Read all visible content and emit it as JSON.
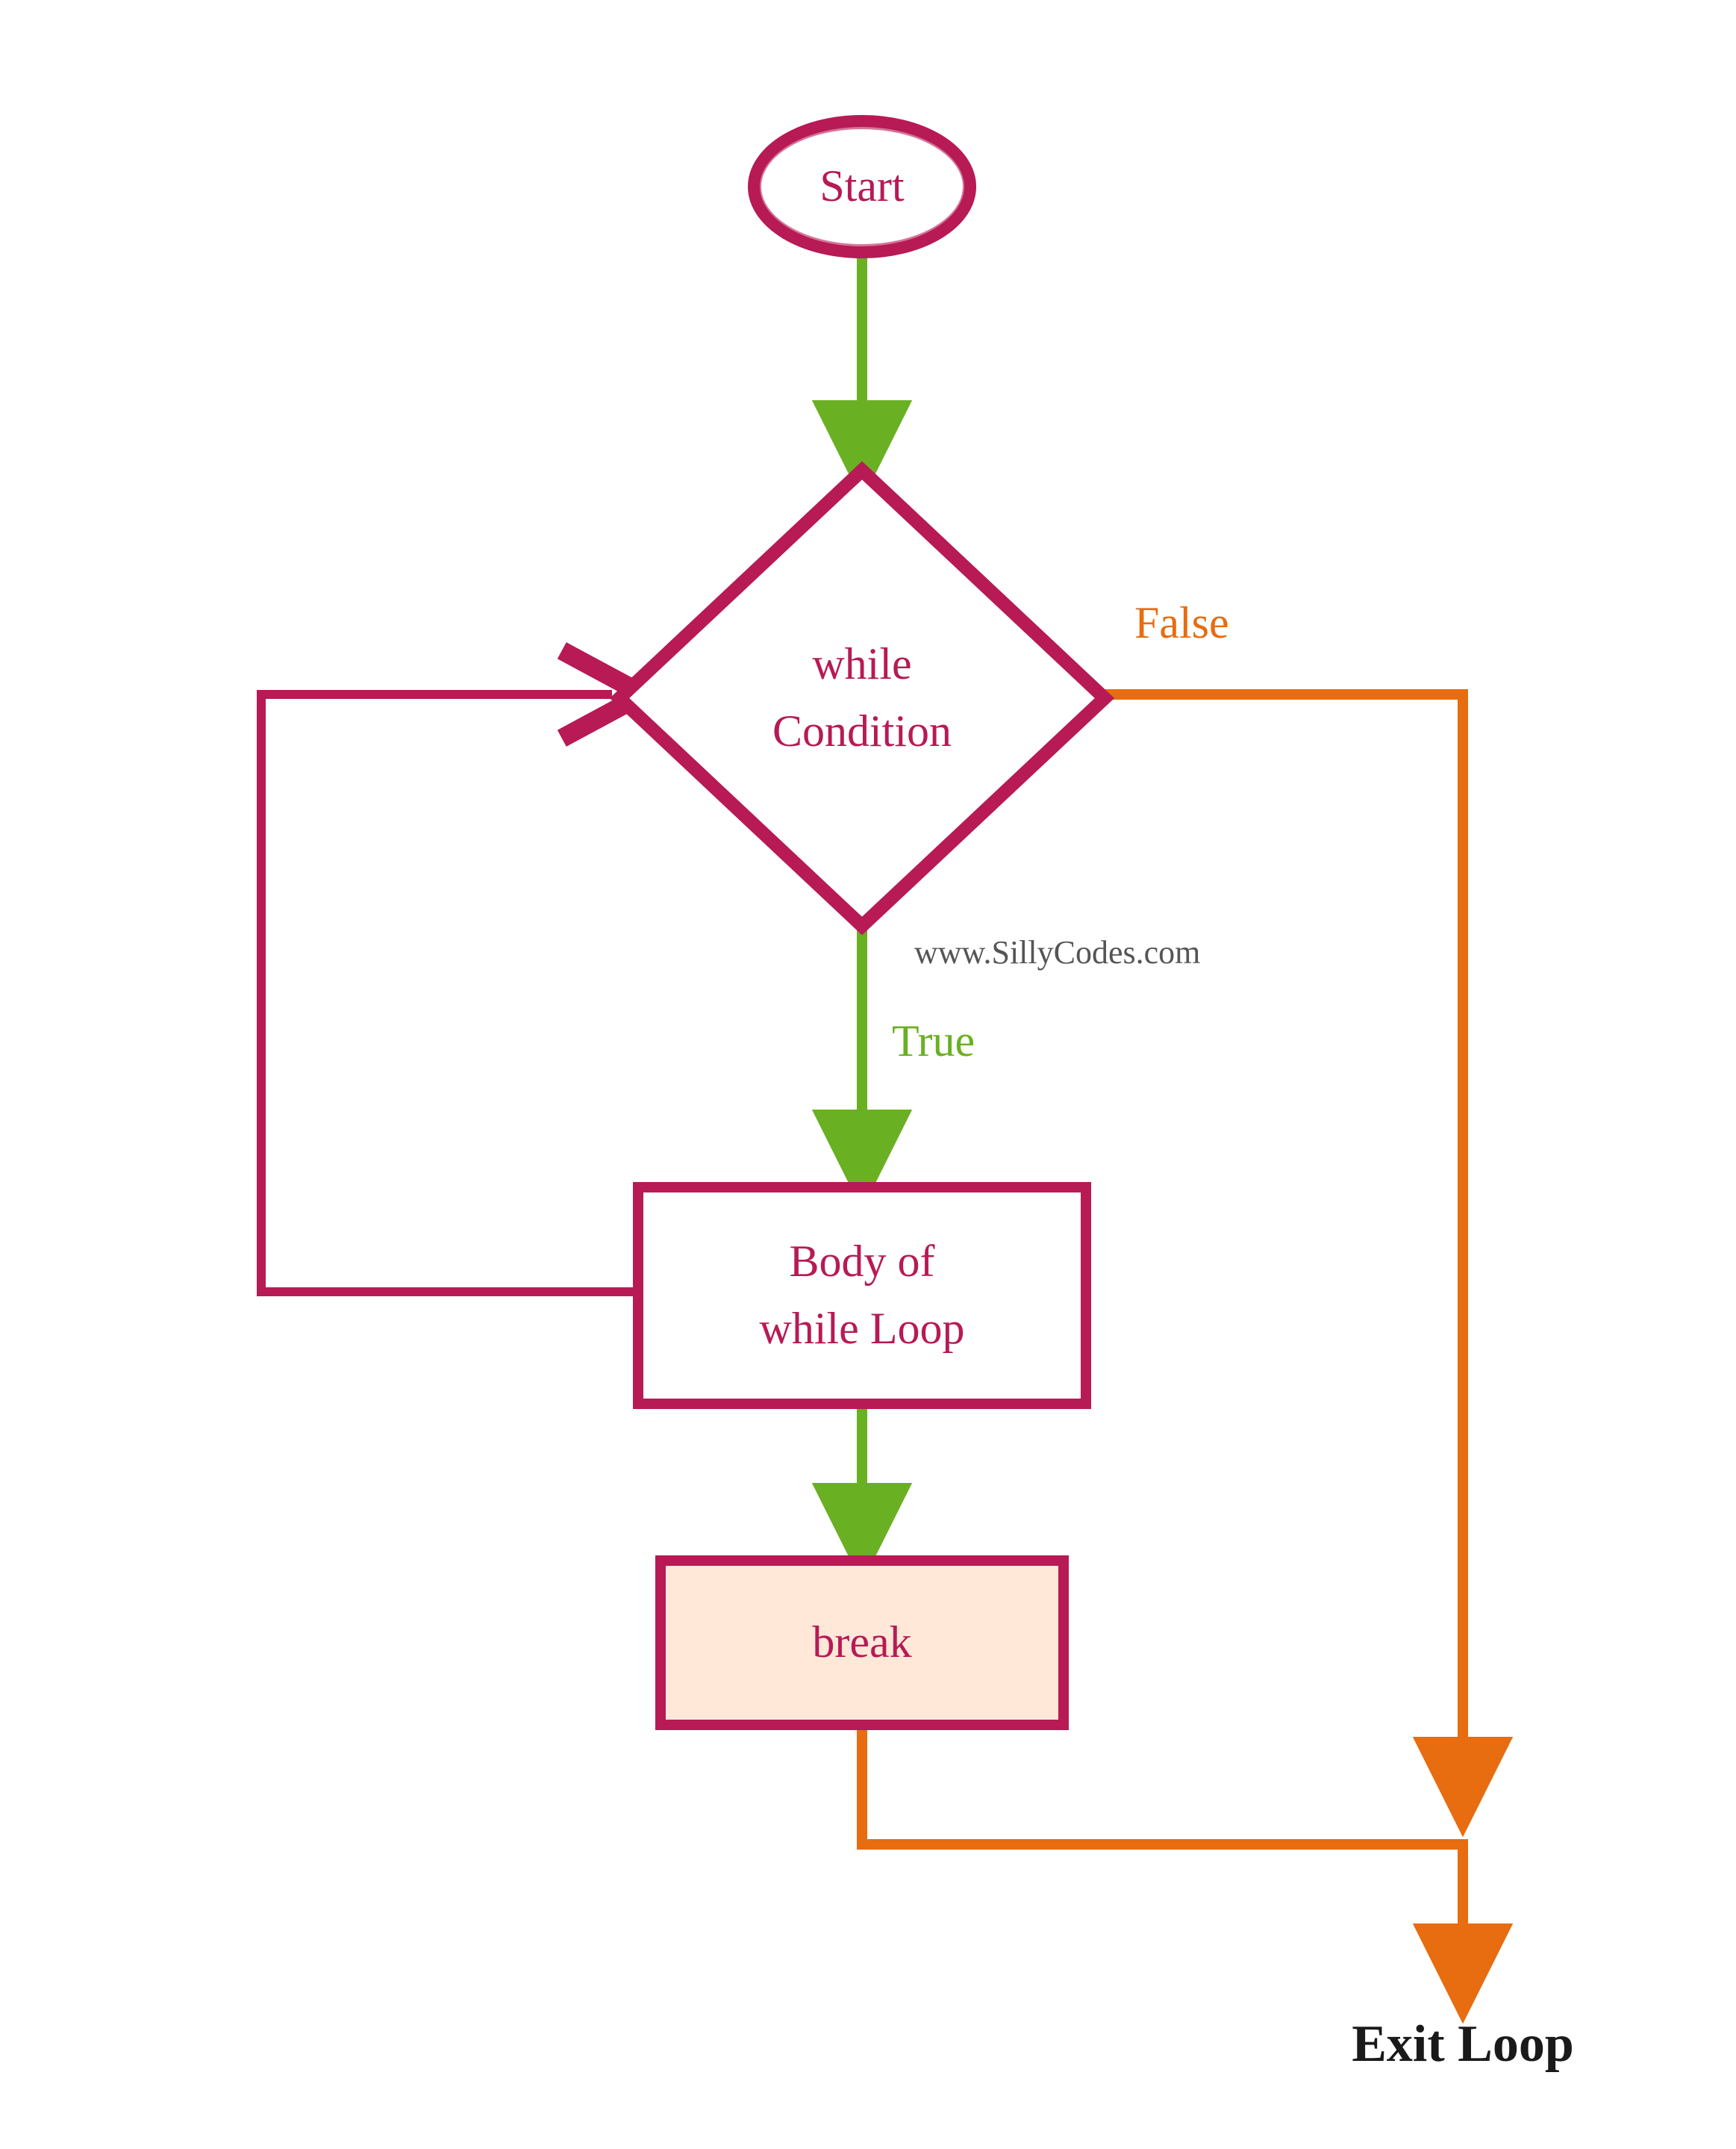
{
  "colors": {
    "magenta": "#b71a55",
    "green": "#6ab023",
    "orange": "#e86c10",
    "orange_fill": "#ffe8d8",
    "text_dark": "#1a1a1a",
    "url_grey": "#555555"
  },
  "nodes": {
    "start": {
      "label": "Start"
    },
    "condition": {
      "line1": "while",
      "line2": "Condition"
    },
    "body": {
      "line1": "Body of",
      "line2": "while Loop"
    },
    "break": {
      "label": "break"
    }
  },
  "edges": {
    "true_label": "True",
    "false_label": "False"
  },
  "terminal": {
    "exit_label": "Exit Loop"
  },
  "watermark": "www.SillyCodes.com"
}
